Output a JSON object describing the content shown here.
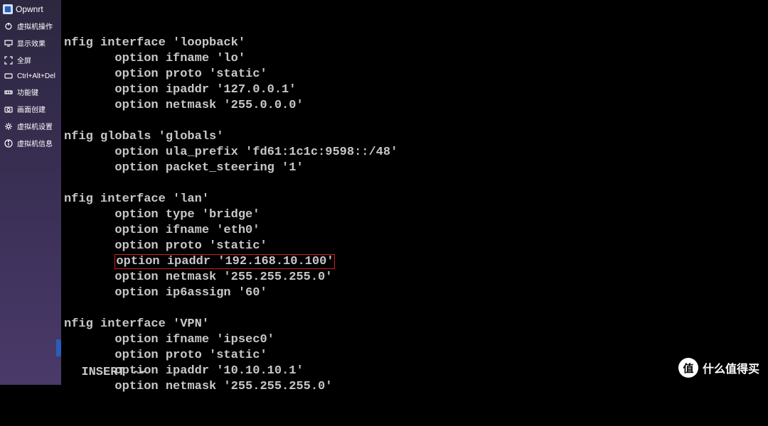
{
  "sidebar": {
    "title": "Opwnrt",
    "items": [
      {
        "label": "虚拟机操作"
      },
      {
        "label": "显示效果"
      },
      {
        "label": "全屏"
      },
      {
        "label": "Ctrl+Alt+Del"
      },
      {
        "label": "功能键"
      },
      {
        "label": "画面创建"
      },
      {
        "label": "虚拟机设置"
      },
      {
        "label": "虚拟机信息"
      }
    ]
  },
  "terminal": {
    "lines": [
      "nfig interface 'loopback'",
      "       option ifname 'lo'",
      "       option proto 'static'",
      "       option ipaddr '127.0.0.1'",
      "       option netmask '255.0.0.0'",
      "",
      "nfig globals 'globals'",
      "       option ula_prefix 'fd61:1c1c:9598::/48'",
      "       option packet_steering '1'",
      "",
      "nfig interface 'lan'",
      "       option type 'bridge'",
      "       option ifname 'eth0'",
      "       option proto 'static'",
      {
        "prefix": "       ",
        "highlighted": "option ipaddr '192.168.10.100'"
      },
      "       option netmask '255.255.255.0'",
      "       option ip6assign '60'",
      "",
      "nfig interface 'VPN'",
      "       option ifname 'ipsec0'",
      "       option proto 'static'",
      "       option ipaddr '10.10.10.1'",
      "       option netmask '255.255.255.0'"
    ],
    "status": "  INSERT --"
  },
  "watermark": {
    "badge": "值",
    "text": "什么值得买"
  }
}
